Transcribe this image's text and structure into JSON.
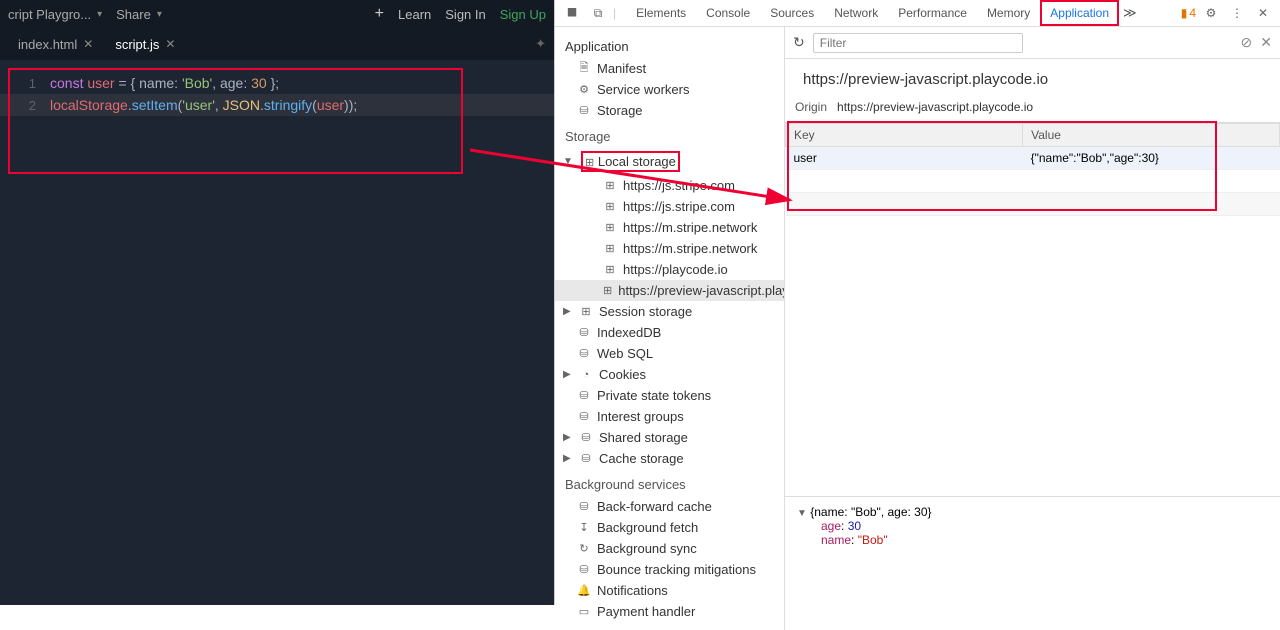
{
  "editor": {
    "title": "cript Playgro...",
    "share": "Share",
    "learn": "Learn",
    "signin": "Sign In",
    "signup": "Sign Up",
    "tabs": [
      {
        "name": "index.html",
        "active": false
      },
      {
        "name": "script.js",
        "active": true
      }
    ],
    "code": {
      "l1_kw": "const",
      "l1_id": "user",
      "l1_eq": " = { ",
      "l1_p1": "name",
      "l1_c1": ": ",
      "l1_s1": "'Bob'",
      "l1_cm": ", ",
      "l1_p2": "age",
      "l1_c2": ": ",
      "l1_n1": "30",
      "l1_end": " };",
      "l2_g": "localStorage",
      "l2_d": ".",
      "l2_f": "setItem",
      "l2_o": "(",
      "l2_s": "'user'",
      "l2_cm": ", ",
      "l2_g2": "JSON",
      "l2_d2": ".",
      "l2_f2": "stringify",
      "l2_o2": "(",
      "l2_id": "user",
      "l2_c": "));"
    }
  },
  "devtools": {
    "tabs": [
      "Elements",
      "Console",
      "Sources",
      "Network",
      "Performance",
      "Memory",
      "Application"
    ],
    "warn_count": "4",
    "side": {
      "app_head": "Application",
      "manifest": "Manifest",
      "sw": "Service workers",
      "storage_top": "Storage",
      "storage_head": "Storage",
      "local": "Local storage",
      "origins": [
        "https://js.stripe.com",
        "https://js.stripe.com",
        "https://m.stripe.network",
        "https://m.stripe.network",
        "https://playcode.io",
        "https://preview-javascript.playcode.io"
      ],
      "session": "Session storage",
      "idb": "IndexedDB",
      "websql": "Web SQL",
      "cookies": "Cookies",
      "pst": "Private state tokens",
      "ig": "Interest groups",
      "shared": "Shared storage",
      "cache": "Cache storage",
      "bg_head": "Background services",
      "bfc": "Back-forward cache",
      "bgf": "Background fetch",
      "bgs": "Background sync",
      "btm": "Bounce tracking mitigations",
      "notif": "Notifications",
      "pay": "Payment handler"
    },
    "filter_ph": "Filter",
    "origin_title": "https://preview-javascript.playcode.io",
    "origin_label": "Origin",
    "origin_val": "https://preview-javascript.playcode.io",
    "th_key": "Key",
    "th_val": "Value",
    "row_key": "user",
    "row_val": "{\"name\":\"Bob\",\"age\":30}",
    "detail_head": "{name: \"Bob\", age: 30}",
    "detail_age_k": "age",
    "detail_age_v": "30",
    "detail_name_k": "name",
    "detail_name_v": "\"Bob\""
  }
}
